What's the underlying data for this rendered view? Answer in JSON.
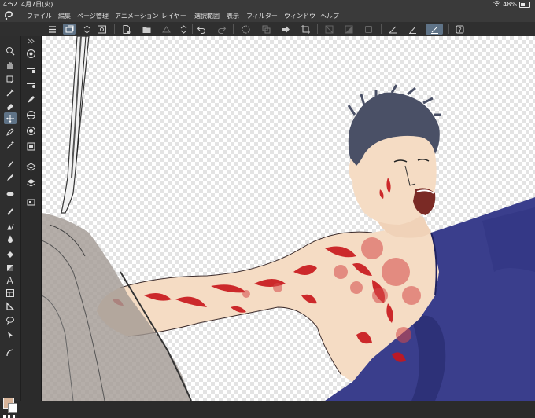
{
  "status": {
    "time": "4:52",
    "date": "4月7日(火)",
    "battery": "48%",
    "battery_level": 0.48
  },
  "menu": {
    "items": [
      "ファイル",
      "編集",
      "ページ管理",
      "アニメーション",
      "レイヤー",
      "選択範囲",
      "表示",
      "フィルター",
      "ウィンドウ",
      "ヘルプ"
    ]
  },
  "toolbar": {
    "icons": [
      "menu-icon",
      "layer-move-icon",
      "updown-icon",
      "eye-icon",
      "new-file-icon",
      "open-folder-icon",
      "save-icon",
      "updown-icon",
      "undo-icon",
      "redo-icon",
      "loading-icon",
      "copy-icon",
      "transform-icon",
      "crop-icon",
      "invert-icon",
      "fill-icon",
      "clear-icon",
      "snap-ruler-icon",
      "snap-brush-icon",
      "snap-line-icon",
      "help-icon"
    ]
  },
  "tools": {
    "primary": [
      "zoom-icon",
      "hand-icon",
      "rotate-icon",
      "eyedropper-icon",
      "eraser-icon",
      "move-icon",
      "pen-icon",
      "magic-wand-icon",
      "brush-icon",
      "pencil-icon",
      "blend-icon",
      "airbrush-icon",
      "watercolor-icon",
      "fill-icon",
      "gradient-icon",
      "text-icon",
      "frame-icon",
      "ruler-icon",
      "balloon-icon",
      "select-icon",
      "curve-icon"
    ],
    "secondary": [
      "circle-target-icon",
      "move-layer-icon",
      "object-move-icon",
      "pen-tool-icon",
      "grid-icon",
      "palette-icon",
      "canvas-icon",
      "layers-icon",
      "layer-stack-icon",
      "navigator-icon"
    ]
  },
  "colors": {
    "main": "#d8b59a",
    "sub": "#ffffff",
    "accent": "#5f7387",
    "robe": "#3a3e8c",
    "skin": "#f5dcc4",
    "blood": "#c8161b",
    "hair": "#4a5066"
  }
}
